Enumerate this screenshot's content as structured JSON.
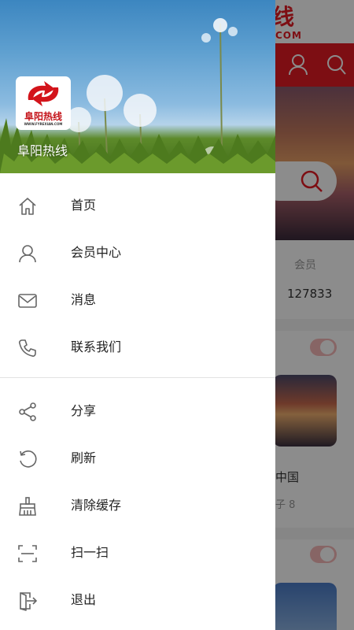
{
  "background_app": {
    "brand_text": "线",
    "brand_sub": "COM",
    "stat_label": "会员",
    "stat_value": "127833",
    "card_title": "中国",
    "card_meta": "子 8"
  },
  "drawer": {
    "logo_text": "阜阳热线",
    "logo_sub": "WWW.FYREXIAN.COM",
    "app_name": "阜阳热线",
    "menu_primary": [
      {
        "label": "首页",
        "icon": "home-icon"
      },
      {
        "label": "会员中心",
        "icon": "user-icon"
      },
      {
        "label": "消息",
        "icon": "mail-icon"
      },
      {
        "label": "联系我们",
        "icon": "phone-icon"
      }
    ],
    "menu_secondary": [
      {
        "label": "分享",
        "icon": "share-icon"
      },
      {
        "label": "刷新",
        "icon": "refresh-icon"
      },
      {
        "label": "清除缓存",
        "icon": "broom-icon"
      },
      {
        "label": "扫一扫",
        "icon": "scan-icon"
      },
      {
        "label": "退出",
        "icon": "exit-icon"
      }
    ]
  },
  "colors": {
    "brand_red": "#e41b23",
    "icon_gray": "#666666",
    "text": "#222222"
  }
}
